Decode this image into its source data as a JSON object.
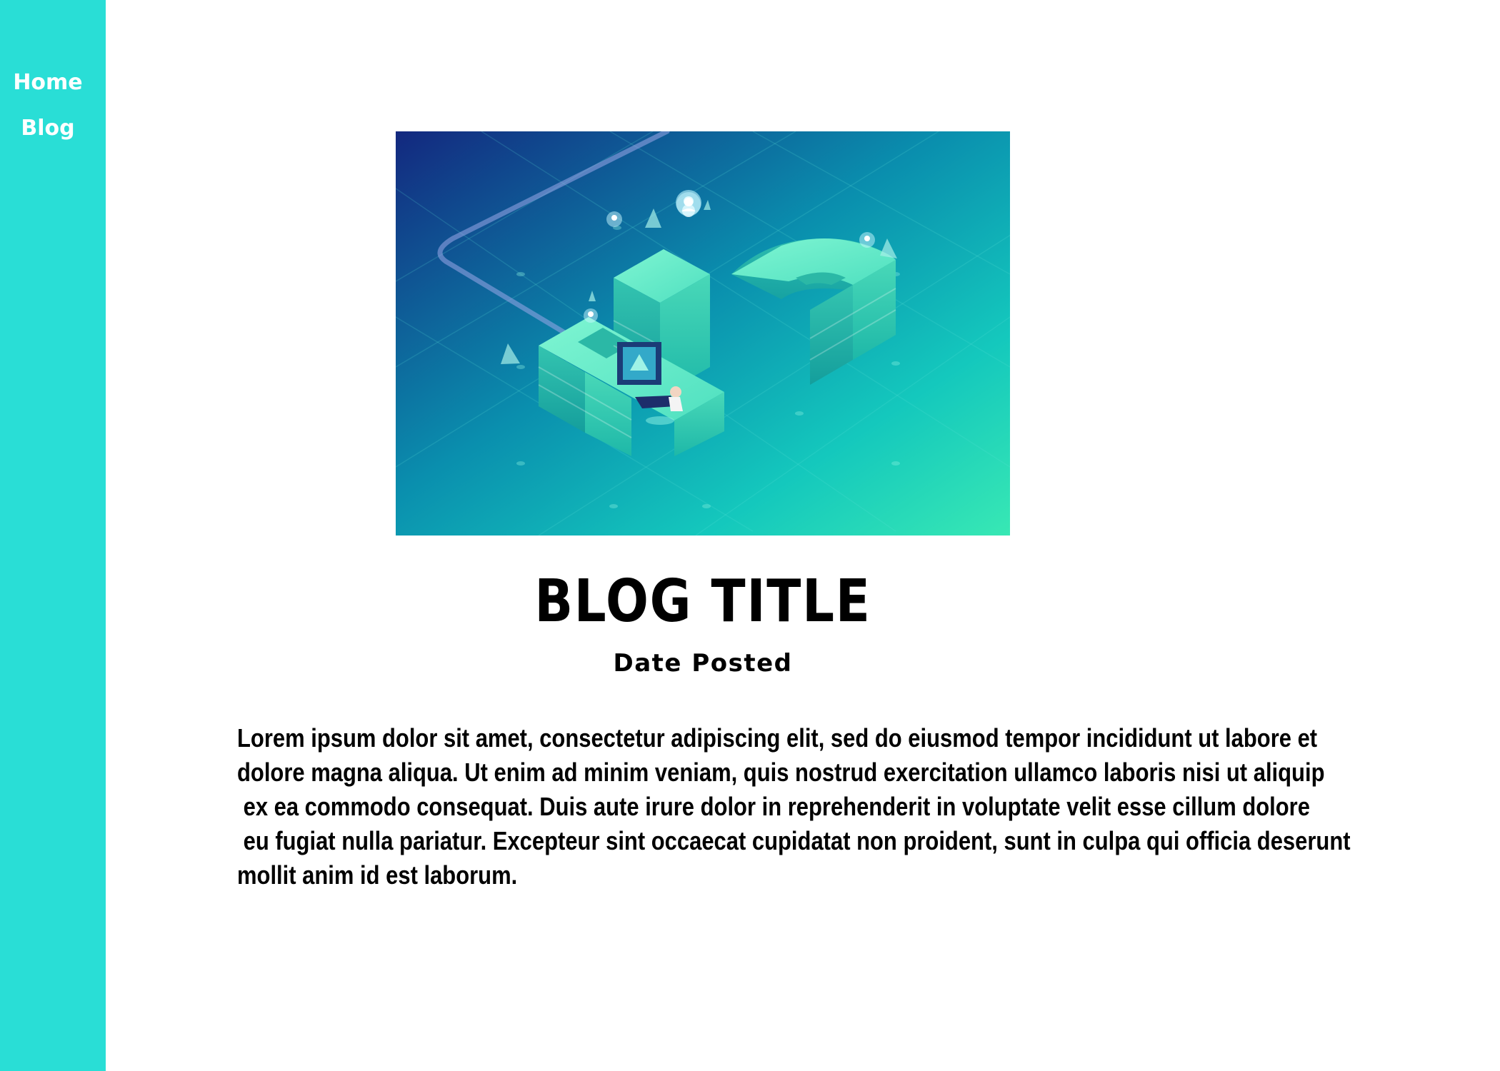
{
  "sidebar": {
    "items": [
      {
        "label": "Home"
      },
      {
        "label": "Blog"
      }
    ],
    "background": "#29ded6"
  },
  "post": {
    "title": "BLOG TITLE",
    "date": "Date Posted",
    "body_lines": [
      "Lorem ipsum dolor sit amet, consectetur adipiscing elit, sed do eiusmod tempor incididunt ut labore et",
      "dolore magna aliqua. Ut enim ad minim veniam, quis nostrud exercitation ullamco laboris nisi ut aliquip",
      " ex ea commodo consequat. Duis aute irure dolor in reprehenderit in voluptate velit esse cillum dolore",
      " eu fugiat nulla pariatur. Excepteur sint occaecat cupidatat non proident, sunt in culpa qui officia deserunt",
      "mollit anim id est laborum."
    ],
    "hero_image": {
      "icon": "facebook-isometric-illustration",
      "colors": {
        "top_left": "#13287f",
        "bottom_right": "#38e8b4",
        "mid": "#0aa6b0"
      }
    }
  }
}
